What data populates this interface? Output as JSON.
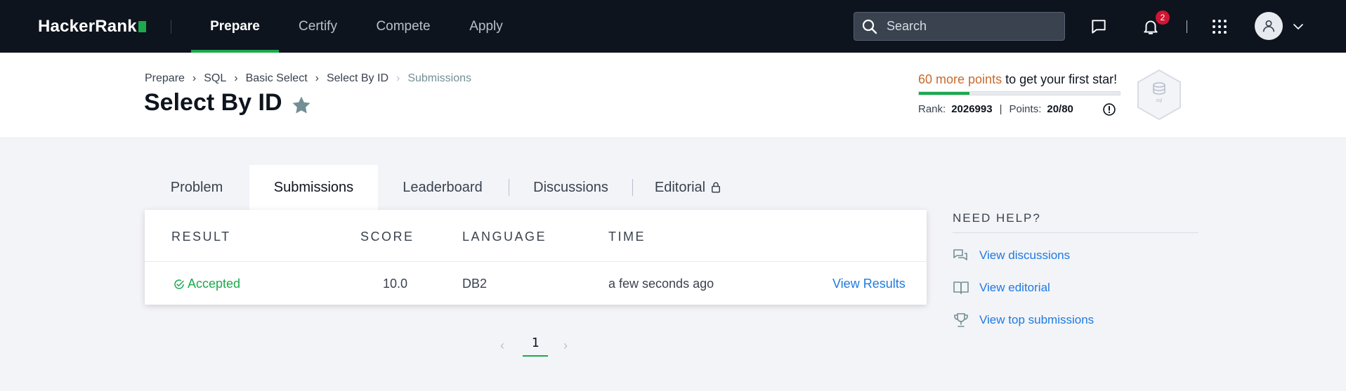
{
  "nav": {
    "brand": "HackerRank",
    "links": [
      {
        "label": "Prepare",
        "active": true
      },
      {
        "label": "Certify",
        "active": false
      },
      {
        "label": "Compete",
        "active": false
      },
      {
        "label": "Apply",
        "active": false
      }
    ],
    "search_placeholder": "Search",
    "notifications_count": "2",
    "icons": [
      "search-icon",
      "chat-icon",
      "bell-icon",
      "apps-grid-icon",
      "user-icon",
      "chevron-down-icon"
    ]
  },
  "breadcrumb": [
    "Prepare",
    "SQL",
    "Basic Select",
    "Select By ID",
    "Submissions"
  ],
  "title": "Select By ID",
  "progress": {
    "points_text": "60 more points",
    "rest_text": " to get your first star!",
    "fraction": 0.25,
    "rank_label": "Rank:",
    "rank_value": "2026993",
    "points_label": "Points:",
    "points_value": "20/80",
    "badge_label": "sql"
  },
  "tabs": [
    "Problem",
    "Submissions",
    "Leaderboard",
    "Discussions",
    "Editorial"
  ],
  "table": {
    "headers": [
      "RESULT",
      "SCORE",
      "LANGUAGE",
      "TIME"
    ],
    "rows": [
      {
        "result": "Accepted",
        "score": "10.0",
        "language": "DB2",
        "time": "a few seconds ago",
        "action": "View Results"
      }
    ]
  },
  "pagination": {
    "current": "1",
    "prev": "‹",
    "next": "›"
  },
  "help": {
    "title": "NEED HELP?",
    "items": [
      "View discussions",
      "View editorial",
      "View top submissions"
    ]
  },
  "colors": {
    "accent_green": "#1ba94c",
    "link_blue": "#1f7ae0",
    "nav_bg": "#0e141e",
    "points_orange": "#c86a2d"
  }
}
